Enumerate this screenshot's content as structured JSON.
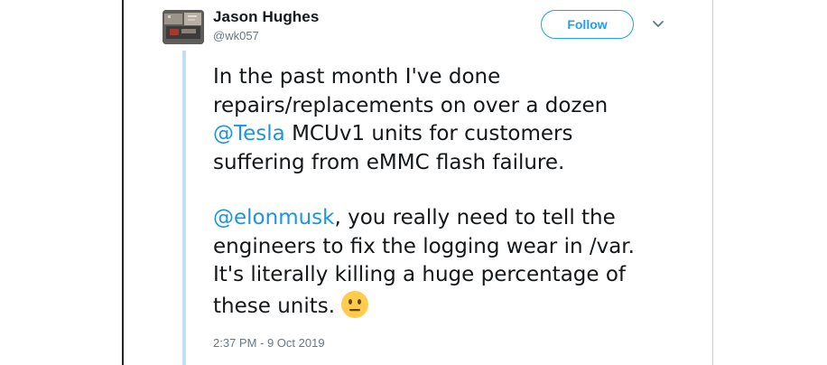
{
  "author": {
    "name": "Jason Hughes",
    "handle": "@wk057",
    "avatar_icon": "avatar-image"
  },
  "follow_button": {
    "label": "Follow"
  },
  "menu_icon": "chevron-down-icon",
  "tweet": {
    "paragraph1": {
      "line1": "In the past month I've done",
      "line2": "repairs/replacements on over a dozen",
      "line3_mention": "@Tesla",
      "line3_rest": " MCUv1 units for customers",
      "line4": "suffering from eMMC flash failure."
    },
    "paragraph2": {
      "line1_mention": "@elonmusk",
      "line1_rest": ", you really need to tell the",
      "line2": "engineers to fix the logging wear in /var.",
      "line3": "It's literally killing a huge percentage of",
      "line4": "these units.",
      "emoji": "neutral-face-emoji"
    }
  },
  "timestamp": "2:37 PM - 9 Oct 2019",
  "colors": {
    "link": "#1b95e0",
    "follow": "#1da1f2",
    "thread_line": "#c4dff2",
    "text": "#14171a",
    "muted": "#657786"
  }
}
